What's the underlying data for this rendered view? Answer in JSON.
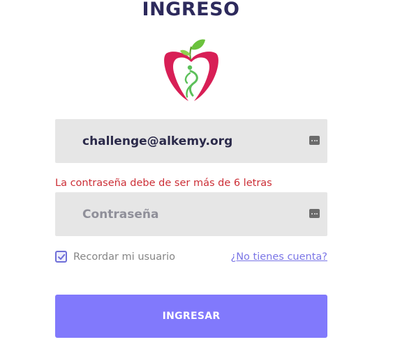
{
  "title": "INGRESO",
  "logo": {
    "icon": "apple-figure-logo",
    "colors": {
      "apple": "#d81f56",
      "leaf": "#6bc23d",
      "figure": "#5cc05a"
    }
  },
  "email_field": {
    "value": "challenge@alkemy.org",
    "icon": "password-manager-icon"
  },
  "error_message": "La contraseña debe de ser más de 6 letras",
  "password_field": {
    "value": "",
    "placeholder": "Contraseña",
    "icon": "password-manager-icon"
  },
  "remember": {
    "label": "Recordar mi usuario",
    "checked": true
  },
  "signup_link": "¿No tienes cuenta?",
  "submit_label": "INGRESAR",
  "colors": {
    "title": "#2d2a5c",
    "accent": "#8179fc",
    "error": "#cc2e36",
    "field_bg": "#e6e6e6"
  }
}
